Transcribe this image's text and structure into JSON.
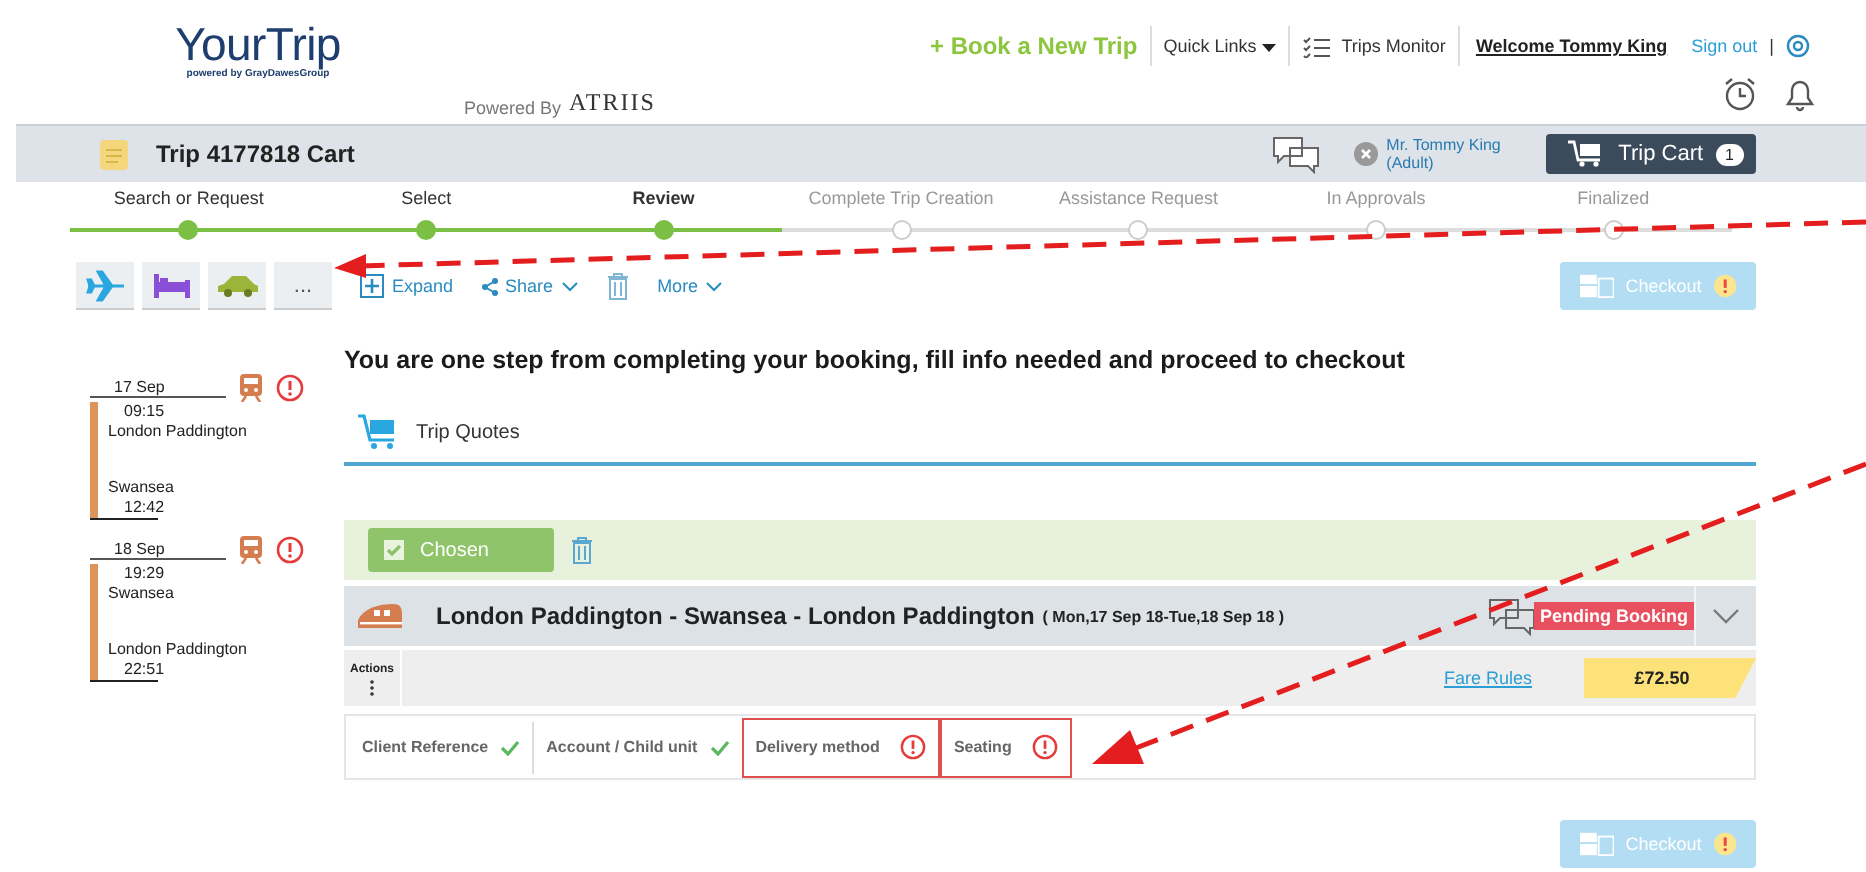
{
  "header": {
    "logo": "YourTrip",
    "logo_tagline": "powered by GrayDawesGroup",
    "powered_by": "Powered By",
    "powered_brand": "ATRIIS",
    "book_link": "+ Book a New Trip",
    "quick_links": "Quick Links",
    "trips_monitor": "Trips Monitor",
    "welcome": "Welcome Tommy King",
    "sign_out": "Sign out",
    "separator": "|"
  },
  "cart_bar": {
    "title": "Trip 4177818 Cart",
    "traveler": "Mr. Tommy King (Adult)",
    "cart_button": "Trip Cart",
    "cart_count": "1"
  },
  "steps": [
    {
      "label": "Search or Request",
      "completed": true,
      "selected": false
    },
    {
      "label": "Select",
      "completed": true,
      "selected": false
    },
    {
      "label": "Review",
      "completed": true,
      "selected": true
    },
    {
      "label": "Complete Trip Creation",
      "completed": false,
      "selected": false
    },
    {
      "label": "Assistance Request",
      "completed": false,
      "selected": false
    },
    {
      "label": "In Approvals",
      "completed": false,
      "selected": false
    },
    {
      "label": "Finalized",
      "completed": false,
      "selected": false
    }
  ],
  "add_buttons": [
    {
      "kind": "flight"
    },
    {
      "kind": "hotel"
    },
    {
      "kind": "car"
    },
    {
      "kind": "more",
      "label": "..."
    }
  ],
  "toolbar": {
    "expand": "Expand",
    "share": "Share",
    "more": "More"
  },
  "checkout": "Checkout",
  "segments": [
    {
      "date": "17 Sep",
      "depart_time": "09:15",
      "from": "London Paddington",
      "to": "Swansea",
      "arrive_time": "12:42",
      "warning": true
    },
    {
      "date": "18 Sep",
      "depart_time": "19:29",
      "from": "Swansea",
      "to": "London Paddington",
      "arrive_time": "22:51",
      "warning": true
    }
  ],
  "headline": "You are one step from completing your booking, fill info needed and proceed to checkout",
  "tabs": [
    {
      "label": "Trip Quotes",
      "selected": true
    }
  ],
  "quote": {
    "chosen_label": "Chosen",
    "chosen": true,
    "title": "London Paddington - Swansea - London Paddington",
    "dates": "( Mon,17 Sep 18-Tue,18 Sep 18 )",
    "status": "Pending Booking",
    "actions_label": "Actions",
    "fare_rules": "Fare Rules",
    "price": "£72.50"
  },
  "requirements": [
    {
      "label": "Client Reference",
      "complete": true
    },
    {
      "label": "Account / Child unit",
      "complete": true
    },
    {
      "label": "Delivery method",
      "complete": false
    },
    {
      "label": "Seating",
      "complete": false
    }
  ],
  "bottom_checkout": "Checkout"
}
